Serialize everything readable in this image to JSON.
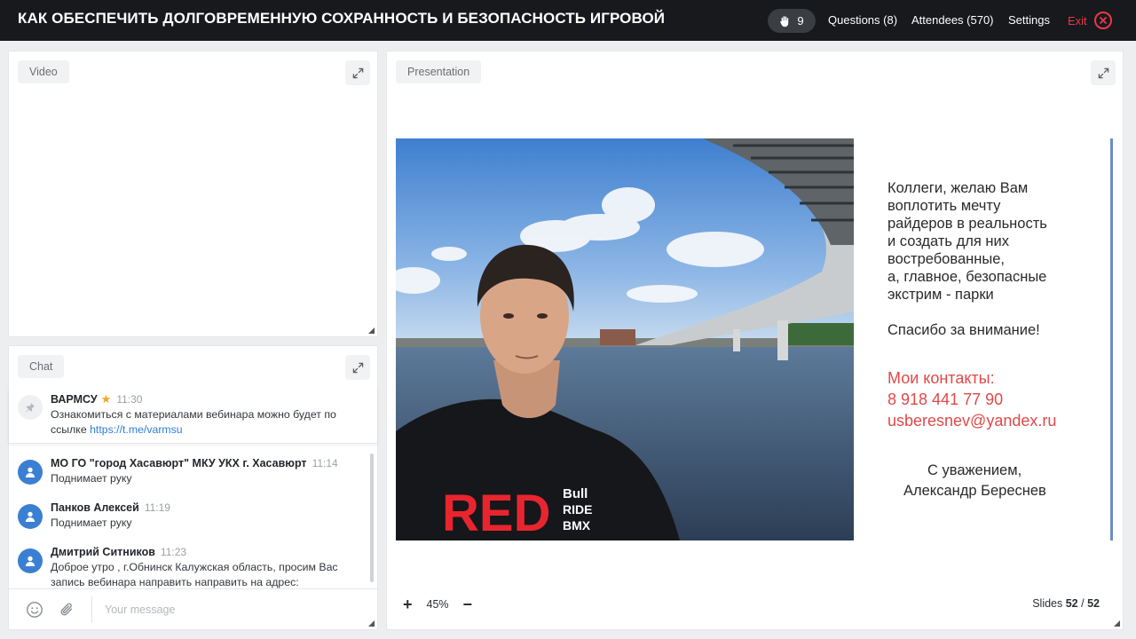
{
  "header": {
    "title": "КАК ОБЕСПЕЧИТЬ ДОЛГОВРЕМЕННУЮ СОХРАННОСТЬ И БЕЗОПАСНОСТЬ ИГРОВОЙ",
    "hands_count": "9",
    "questions": "Questions (8)",
    "attendees": "Attendees (570)",
    "settings": "Settings",
    "exit": "Exit"
  },
  "video": {
    "tag": "Video"
  },
  "chat": {
    "tag": "Chat",
    "pinned": {
      "name": "ВАРМСУ",
      "time": "11:30",
      "text": "Ознакомиться с материалами вебинара можно будет по ссылке",
      "link": "https://t.me/varmsu"
    },
    "messages": [
      {
        "name": "МО ГО \"город Хасавюрт\" МКУ УКХ г. Хасавюрт",
        "time": "11:14",
        "text": "Поднимает руку"
      },
      {
        "name": "Панков Алексей",
        "time": "11:19",
        "text": "Поднимает руку"
      },
      {
        "name": "Дмитрий Ситников",
        "time": "11:23",
        "text": "Доброе утро , г.Обнинск Калужская область, просим Вас запись вебинара направить направить на адрес:"
      }
    ],
    "input_placeholder": "Your message"
  },
  "presentation": {
    "tag": "Presentation",
    "zoom": "45%",
    "slides_label": "Slides",
    "slide_current": "52",
    "slide_sep": "/",
    "slide_total": "52",
    "slide": {
      "tshirt": "RED",
      "brand_lines": [
        "Bull",
        "RIDE",
        "BMX"
      ],
      "wish_lines": [
        "Коллеги, желаю Вам",
        "воплотить мечту",
        "райдеров в реальность",
        "и создать для них",
        "востребованные,",
        "а, главное, безопасные",
        "экстрим - парки"
      ],
      "thanks": "Спасибо за внимание!",
      "contacts_label": "Мои контакты:",
      "phone": "8 918 441 77 90",
      "email": "usberesnev@yandex.ru",
      "regards": "С уважением,",
      "author": "Александр Береснев"
    }
  },
  "colors": {
    "topbar": "#17191c",
    "exit": "#e8394a",
    "avatar": "#3b7fd2",
    "link": "#2b7fd9",
    "slide_red": "#e04848"
  }
}
